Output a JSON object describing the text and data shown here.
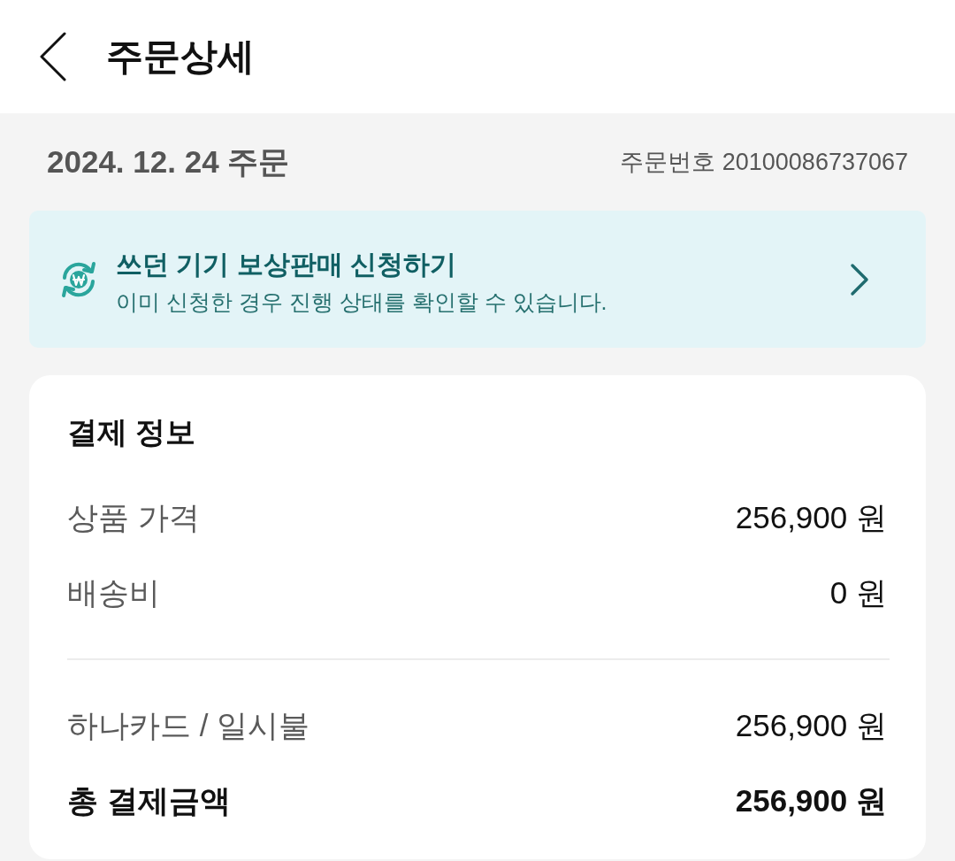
{
  "header": {
    "title": "주문상세"
  },
  "order": {
    "date": "2024. 12. 24 주문",
    "number": "주문번호 20100086737067"
  },
  "banner": {
    "title": "쓰던 기기 보상판매 신청하기",
    "subtitle": "이미 신청한 경우 진행 상태를 확인할 수 있습니다."
  },
  "payment": {
    "title": "결제 정보",
    "breakdown": [
      {
        "kind": "line",
        "label": "상품 가격",
        "value": "256,900 원"
      },
      {
        "kind": "line",
        "label": "배송비",
        "value": "0 원"
      }
    ],
    "settlement": [
      {
        "kind": "line",
        "label": "하나카드 / 일시불",
        "value": "256,900 원"
      },
      {
        "kind": "total",
        "label": "총 결제금액",
        "value": "256,900 원"
      }
    ]
  }
}
